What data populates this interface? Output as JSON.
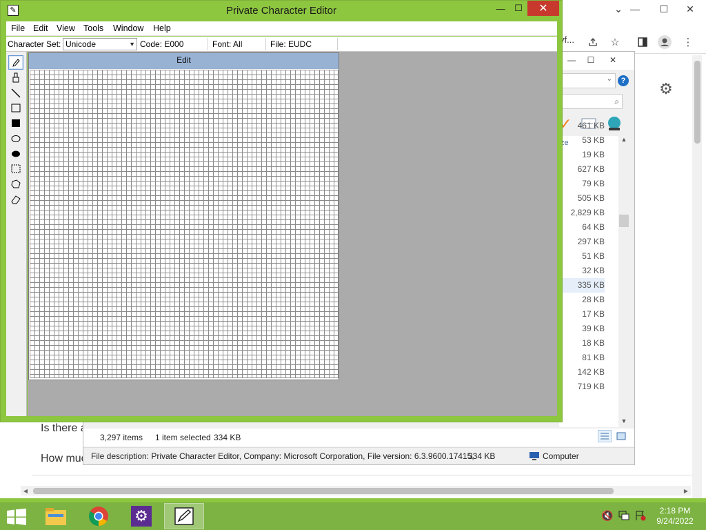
{
  "chrome": {
    "omnibox_tail": "vf...",
    "page_line_1": "Is there a",
    "page_line_2": "How muc"
  },
  "explorer": {
    "file_sizes": [
      "461 KB",
      "53 KB",
      "19 KB",
      "627 KB",
      "79 KB",
      "505 KB",
      "2,829 KB",
      "64 KB",
      "297 KB",
      "51 KB",
      "32 KB",
      "335 KB",
      "28 KB",
      "17 KB",
      "39 KB",
      "18 KB",
      "81 KB",
      "142 KB",
      "719 KB"
    ],
    "selected_index": 11,
    "column_header": "ze",
    "status": {
      "items_count": "3,297 items",
      "selected": "1 item selected",
      "selected_size": "334 KB"
    },
    "details": {
      "description": "File description: Private Character Editor, Company: Microsoft Corporation, File version: 6.3.9600.17415,",
      "size": "334 KB",
      "location": "Computer"
    }
  },
  "pce": {
    "title": "Private Character Editor",
    "menu": [
      "File",
      "Edit",
      "View",
      "Tools",
      "Window",
      "Help"
    ],
    "infobar": {
      "charset_label": "Character Set:",
      "charset_value": "Unicode",
      "code": "Code: E000",
      "font": "Font: All",
      "file": "File: EUDC"
    },
    "edit_window_title": "Edit",
    "tools": [
      "pencil-icon",
      "brush-icon",
      "line-icon",
      "hollow-rectangle-icon",
      "filled-rectangle-icon",
      "hollow-ellipse-icon",
      "filled-ellipse-icon",
      "rectangular-selection-icon",
      "freeform-selection-icon",
      "eraser-icon"
    ]
  },
  "taskbar": {
    "time": "2:18 PM",
    "date": "9/24/2022",
    "apps": [
      "file-explorer",
      "google-chrome",
      "settings",
      "private-character-editor"
    ]
  },
  "colors": {
    "desktop": "#8dc63f",
    "taskbar": "#7cb342",
    "close_button": "#c7392d",
    "edit_titlebar": "#98b2d4",
    "workarea": "#ababab"
  }
}
